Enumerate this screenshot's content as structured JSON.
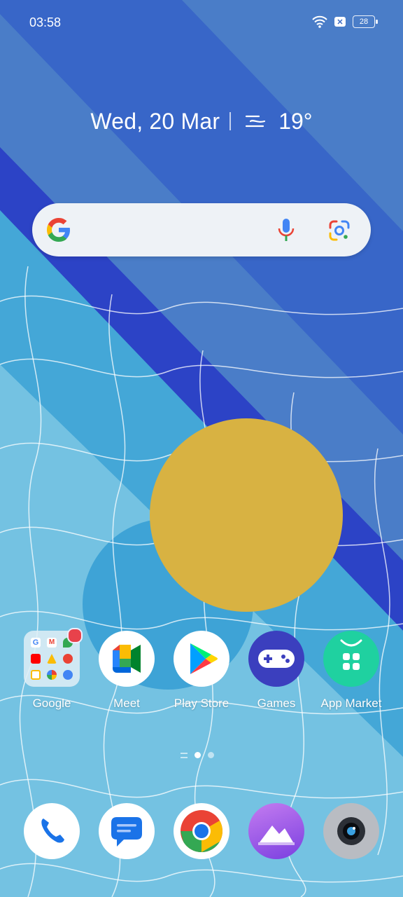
{
  "status_bar": {
    "time": "03:58",
    "battery": "28",
    "icons": [
      "wifi-icon",
      "x-box-icon",
      "battery-icon"
    ]
  },
  "date_widget": {
    "date": "Wed, 20 Mar",
    "temperature": "19°",
    "weather_icon": "haze-icon"
  },
  "search_bar": {
    "icons": [
      "google-logo-icon",
      "microphone-icon",
      "google-lens-icon"
    ]
  },
  "apps": [
    {
      "label": "Google",
      "icon": "google-folder-icon",
      "badge": true
    },
    {
      "label": "Meet",
      "icon": "meet-icon"
    },
    {
      "label": "Play Store",
      "icon": "play-store-icon"
    },
    {
      "label": "Games",
      "icon": "games-icon"
    },
    {
      "label": "App Market",
      "icon": "app-market-icon"
    }
  ],
  "page_indicator": {
    "pages": 2,
    "current": 1
  },
  "dock": [
    {
      "icon": "phone-icon"
    },
    {
      "icon": "messages-icon"
    },
    {
      "icon": "chrome-icon"
    },
    {
      "icon": "gallery-icon"
    },
    {
      "icon": "camera-icon"
    }
  ],
  "colors": {
    "wallpaper_top": "#3f6fc4",
    "wallpaper_band": "#2d45c8",
    "wallpaper_light": "#6cbfe0",
    "sun": "#d9b342"
  }
}
